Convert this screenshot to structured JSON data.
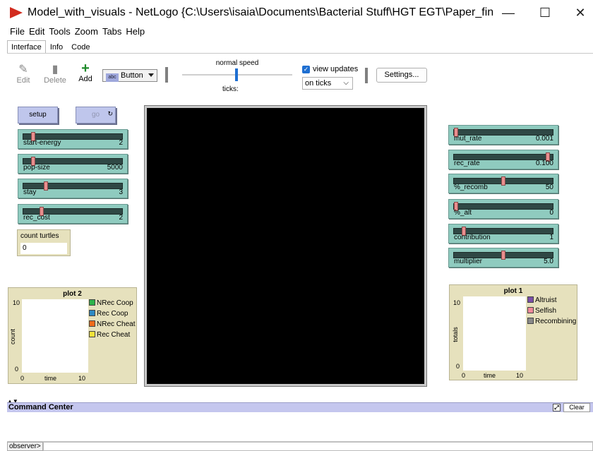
{
  "window": {
    "title": "Model_with_visuals - NetLogo {C:\\Users\\isaia\\Documents\\Bacterial Stuff\\HGT EGT\\Paper_final\\Upda...",
    "minimize": "—",
    "maximize": "☐",
    "close": "✕",
    "app_icon": "netlogo-logo"
  },
  "menu": [
    "File",
    "Edit",
    "Tools",
    "Zoom",
    "Tabs",
    "Help"
  ],
  "tabs": [
    "Interface",
    "Info",
    "Code"
  ],
  "toolbar": {
    "edit": "Edit",
    "delete": "Delete",
    "add": "Add",
    "widget_type": "Button",
    "widget_type_icon": "abc",
    "speed_label": "normal speed",
    "ticks_label": "ticks:",
    "view_updates_label": "view updates",
    "view_updates_checked": true,
    "update_mode": "on ticks",
    "settings": "Settings..."
  },
  "buttons": {
    "setup": "setup",
    "go": "go"
  },
  "sliders_left": [
    {
      "name": "start-energy",
      "value": "2",
      "pos": 0.08
    },
    {
      "name": "pop-size",
      "value": "5000",
      "pos": 0.08
    },
    {
      "name": "stay",
      "value": "3",
      "pos": 0.22
    },
    {
      "name": "rec_cost",
      "value": "2",
      "pos": 0.17
    }
  ],
  "sliders_right": [
    {
      "name": "mut_rate",
      "value": "0.001",
      "pos": 0.0
    },
    {
      "name": "rec_rate",
      "value": "0.100",
      "pos": 0.97
    },
    {
      "name": "%_recomb",
      "value": "50",
      "pos": 0.5
    },
    {
      "name": "%_alt",
      "value": "0",
      "pos": 0.0
    },
    {
      "name": "contribution",
      "value": "1",
      "pos": 0.08
    },
    {
      "name": "multiplier",
      "value": "5.0",
      "pos": 0.5
    }
  ],
  "monitor": {
    "label": "count turtles",
    "value": "0"
  },
  "plot2": {
    "title": "plot 2",
    "ymax": "10",
    "ymin": "0",
    "xmin": "0",
    "xmax": "10",
    "xlabel": "time",
    "ylabel": "count",
    "legend": [
      {
        "name": "NRec Coop",
        "color": "#2db34a"
      },
      {
        "name": "Rec Coop",
        "color": "#2f8ac4"
      },
      {
        "name": "NRec Cheat",
        "color": "#ef6b1a"
      },
      {
        "name": "Rec Cheat",
        "color": "#f2e23a"
      }
    ]
  },
  "plot1": {
    "title": "plot 1",
    "ymax": "10",
    "ymin": "0",
    "xmin": "0",
    "xmax": "10",
    "xlabel": "time",
    "ylabel": "totals",
    "legend": [
      {
        "name": "Altruist",
        "color": "#7b4fa8"
      },
      {
        "name": "Selfish",
        "color": "#f08a9a"
      },
      {
        "name": "Recombining",
        "color": "#8a8a8a"
      }
    ]
  },
  "command_center": {
    "title": "Command Center",
    "clear": "Clear",
    "prompt": "observer>",
    "splitter": "▲▼"
  }
}
